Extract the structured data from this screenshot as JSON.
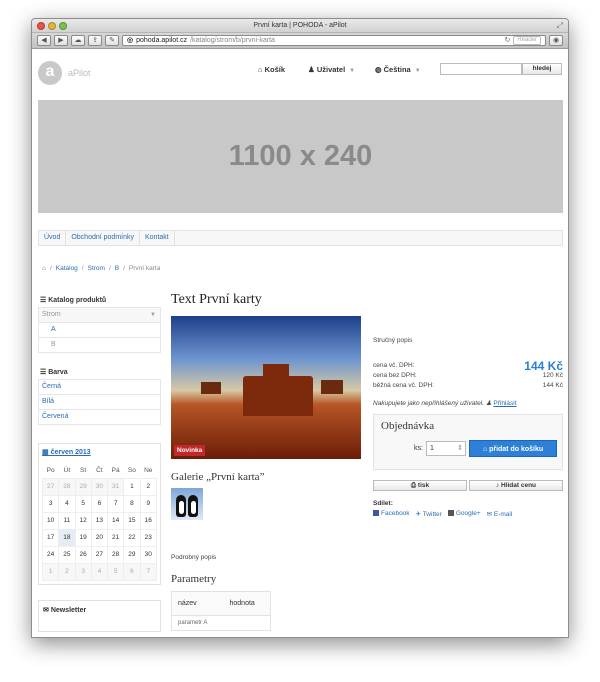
{
  "window": {
    "title": "První karta | POHODA - aPilot"
  },
  "browser": {
    "url_host": "pohoda.apilot.cz",
    "url_path": "/katalog/strom/b/prvni-karta",
    "reload_icon": "reload-icon",
    "reader_label": "Reader"
  },
  "header": {
    "logo_letter": "a",
    "logo_text": "aPilot",
    "cart_label": "Košík",
    "user_label": "Uživatel",
    "language_label": "Čeština",
    "search_placeholder": "",
    "search_button": "hledej"
  },
  "banner": {
    "text": "1100 x 240"
  },
  "menu": [
    "Úvod",
    "Obchodní podmínky",
    "Kontakt"
  ],
  "breadcrumb": {
    "home_icon": "home-icon",
    "items": [
      "Katalog",
      "Strom",
      "B"
    ],
    "current": "První karta"
  },
  "sidebar": {
    "catalog_title": "Katalog produktů",
    "catalog_items": {
      "root": "Strom",
      "a": "A",
      "b": "B"
    },
    "color_title": "Barva",
    "colors": [
      "Černá",
      "Bílá",
      "Červená"
    ],
    "calendar": {
      "month": "červen 2013",
      "weekdays": [
        "Po",
        "Út",
        "St",
        "Čt",
        "Pá",
        "So",
        "Ne"
      ],
      "weeks": [
        [
          "27",
          "28",
          "29",
          "30",
          "31",
          "1",
          "2"
        ],
        [
          "3",
          "4",
          "5",
          "6",
          "7",
          "8",
          "9"
        ],
        [
          "10",
          "11",
          "12",
          "13",
          "14",
          "15",
          "16"
        ],
        [
          "17",
          "18",
          "19",
          "20",
          "21",
          "22",
          "23"
        ],
        [
          "24",
          "25",
          "26",
          "27",
          "28",
          "29",
          "30"
        ],
        [
          "1",
          "2",
          "3",
          "4",
          "5",
          "6",
          "7"
        ]
      ]
    },
    "newsletter_title": "Newsletter"
  },
  "product": {
    "title": "Text První karty",
    "badge": "Novinka",
    "gallery_title": "Galerie „První karta”",
    "long_description": "Podrobný popis",
    "params_title": "Parametry",
    "params_head": [
      "název",
      "hodnota"
    ],
    "params_row": "parametr A"
  },
  "purchase": {
    "short_description": "Stručný popis",
    "price_with_vat_label": "cena vč. DPH:",
    "price_with_vat": "144 Kč",
    "price_without_vat_label": "cena bez DPH:",
    "price_without_vat": "120 Kč",
    "regular_price_label": "běžná cena vč. DPH:",
    "regular_price": "144 Kč",
    "logged_text": "Nakupujete jako nepřihlášený uživatel.",
    "login_link": "Přihlásit",
    "order_title": "Objednávka",
    "qty_label": "ks:",
    "qty_value": "1",
    "add_to_cart": "přidat do košíku",
    "print_label": "tisk",
    "watch_price_label": "Hlídat cenu",
    "share_label": "Sdílet:",
    "share_links": [
      "Facebook",
      "Twitter",
      "Google+",
      "E-mail"
    ]
  }
}
